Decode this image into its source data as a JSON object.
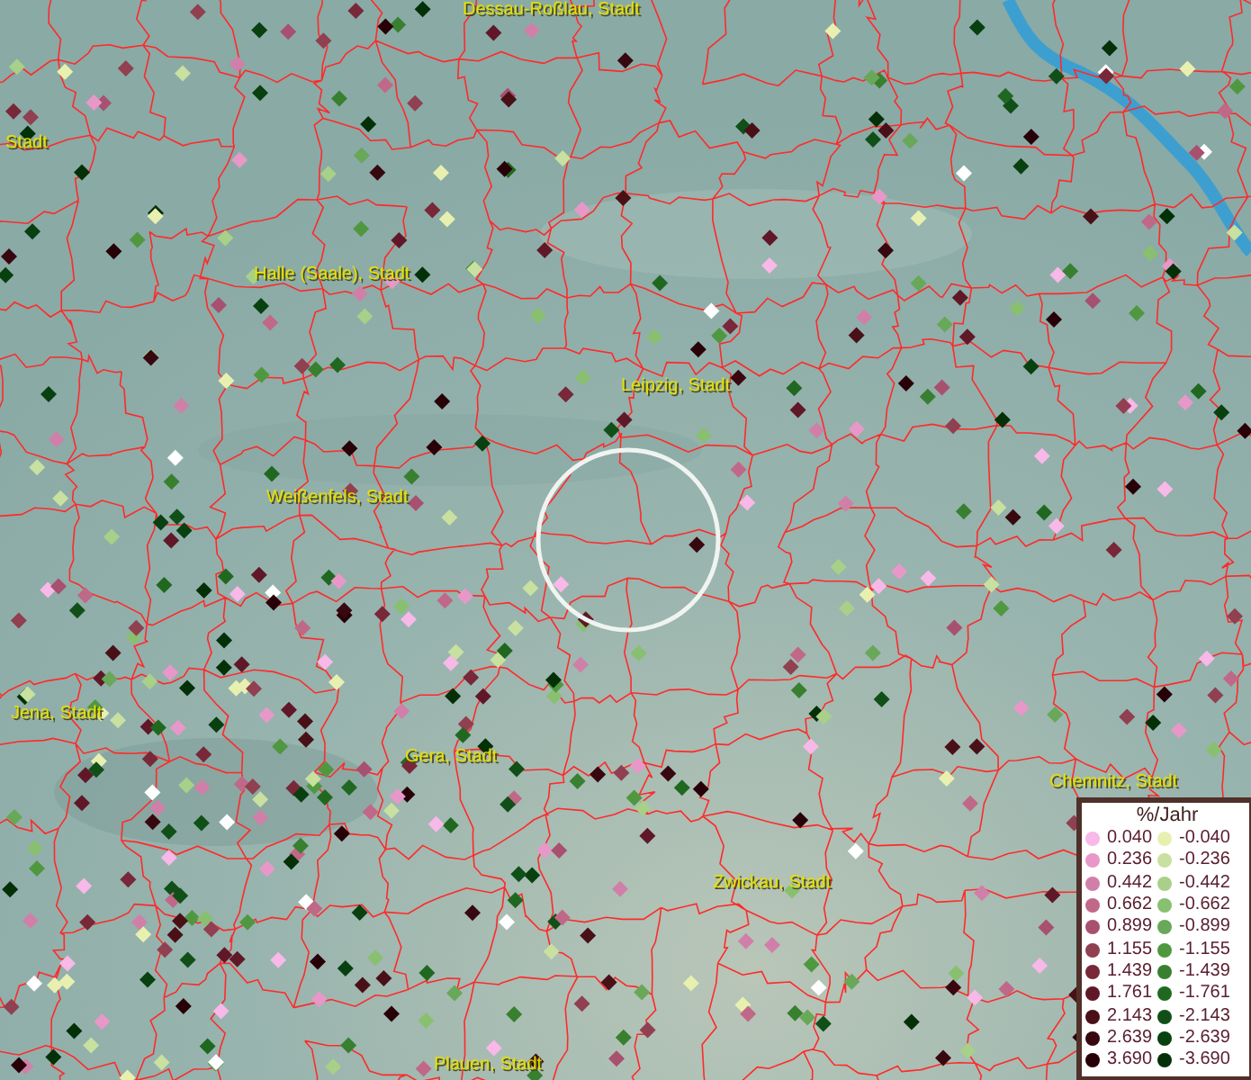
{
  "map": {
    "labels": [
      {
        "text": "Dessau-Roßlau, Stadt"
      },
      {
        "text": "Stadt"
      },
      {
        "text": "Halle (Saale), Stadt"
      },
      {
        "text": "Leipzig, Stadt"
      },
      {
        "text": "Weißenfels, Stadt"
      },
      {
        "text": "Jena, Stadt"
      },
      {
        "text": "Gera, Stadt"
      },
      {
        "text": "Chemnitz, Stadt"
      },
      {
        "text": "Zwickau, Stadt"
      },
      {
        "text": "Plauen, Stadt"
      }
    ]
  },
  "legend": {
    "title": "%/Jahr",
    "positive": [
      {
        "value": "0.040",
        "color": "#f8b8e8"
      },
      {
        "value": "0.236",
        "color": "#e898c8"
      },
      {
        "value": "0.442",
        "color": "#d080a8"
      },
      {
        "value": "0.662",
        "color": "#c06888"
      },
      {
        "value": "0.899",
        "color": "#a85070"
      },
      {
        "value": "1.155",
        "color": "#904050"
      },
      {
        "value": "1.439",
        "color": "#782838"
      },
      {
        "value": "1.761",
        "color": "#601828"
      },
      {
        "value": "2.143",
        "color": "#4a1018"
      },
      {
        "value": "2.639",
        "color": "#380810"
      },
      {
        "value": "3.690",
        "color": "#280008"
      }
    ],
    "negative": [
      {
        "value": "-0.040",
        "color": "#e8f0b0"
      },
      {
        "value": "-0.236",
        "color": "#c8e0a0"
      },
      {
        "value": "-0.442",
        "color": "#a8d088"
      },
      {
        "value": "-0.662",
        "color": "#88c070"
      },
      {
        "value": "-0.899",
        "color": "#68a858"
      },
      {
        "value": "-1.155",
        "color": "#509840"
      },
      {
        "value": "-1.439",
        "color": "#388030"
      },
      {
        "value": "-1.761",
        "color": "#206820"
      },
      {
        "value": "-2.143",
        "color": "#105018"
      },
      {
        "value": "-2.639",
        "color": "#084010"
      },
      {
        "value": "-3.690",
        "color": "#043008"
      }
    ]
  }
}
